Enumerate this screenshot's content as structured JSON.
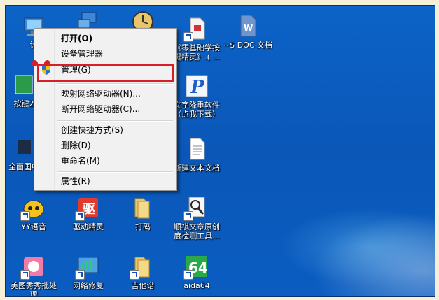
{
  "desktop_icons": [
    {
      "id": "computer",
      "label": "计"
    },
    {
      "id": "network",
      "label": ""
    },
    {
      "id": "clock-app",
      "label": ""
    },
    {
      "id": "zero-basis",
      "label": "《零基础学按键精灵》.( ..."
    },
    {
      "id": "doc",
      "label": "~$ DOC 文档"
    },
    {
      "id": "jianpan",
      "label": "按键2"
    },
    {
      "id": "wenzi",
      "label": "文字降重软件（点我下载）"
    },
    {
      "id": "quanmian",
      "label": "全面国中"
    },
    {
      "id": "txt",
      "label": "新建文本文档"
    },
    {
      "id": "yy",
      "label": "YY语音"
    },
    {
      "id": "qudong",
      "label": "驱动精灵"
    },
    {
      "id": "dama",
      "label": "打码"
    },
    {
      "id": "shunqi",
      "label": "顺祺文章原创度检测工具..."
    },
    {
      "id": "meitu",
      "label": "美图秀秀批处理"
    },
    {
      "id": "wangluo",
      "label": "网络修复"
    },
    {
      "id": "jita",
      "label": "吉他谱"
    },
    {
      "id": "aida",
      "label": "aida64"
    }
  ],
  "context_menu": {
    "items": [
      {
        "label": "打开(O)",
        "bold": true
      },
      {
        "label": "设备管理器"
      },
      {
        "label": "管理(G)",
        "highlighted": true
      },
      {
        "label": "映射网络驱动器(N)..."
      },
      {
        "label": "断开网络驱动器(C)..."
      },
      {
        "label": "创建快捷方式(S)"
      },
      {
        "label": "删除(D)"
      },
      {
        "label": "重命名(M)"
      },
      {
        "label": "属性(R)"
      }
    ]
  },
  "colors": {
    "desktop": "#0b5dc1",
    "highlight": "#d81e26",
    "menu_bg": "#f1f1f1"
  }
}
